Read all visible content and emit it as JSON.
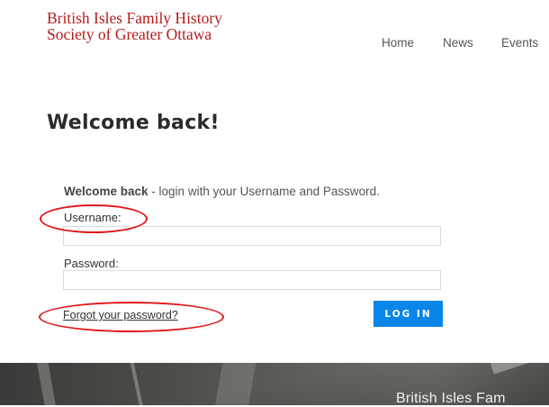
{
  "site": {
    "name_line1": "British Isles Family History",
    "name_line2": "Society of Greater Ottawa"
  },
  "nav": {
    "items": [
      {
        "label": "Home"
      },
      {
        "label": "News"
      },
      {
        "label": "Events"
      }
    ]
  },
  "page": {
    "title": "Welcome back!",
    "intro_bold": "Welcome back",
    "intro_rest": " - login with your Username and Password."
  },
  "form": {
    "username_label": "Username:",
    "username_value": "",
    "password_label": "Password:",
    "password_value": "",
    "forgot_label": "Forgot your password?",
    "login_label": "LOG IN"
  },
  "banner": {
    "text": "British Isles Fam"
  },
  "colors": {
    "brand": "#b71c1c",
    "accent": "#0a85e8",
    "annotation": "#e01818"
  }
}
